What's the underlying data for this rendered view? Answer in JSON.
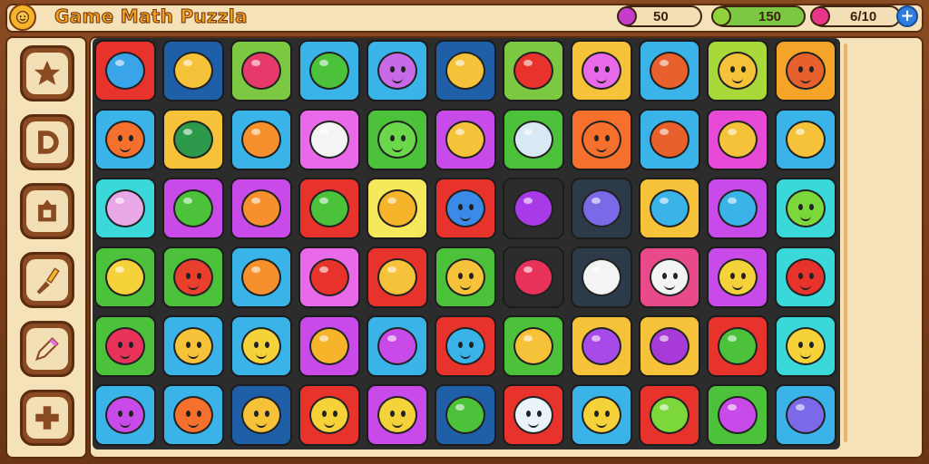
{
  "header": {
    "title": "Game Math Puzzla",
    "resources": [
      {
        "value": "50",
        "gem_color": "#c43cc8"
      },
      {
        "value": "150",
        "gem_color": "#8fd23a"
      },
      {
        "value": "6/10",
        "gem_color": "#e8358a"
      }
    ],
    "plus_label": "+"
  },
  "sidebar": {
    "items": [
      {
        "name": "star-icon"
      },
      {
        "name": "letter-d-icon"
      },
      {
        "name": "lock-icon"
      },
      {
        "name": "brush-icon"
      },
      {
        "name": "pencil-icon"
      },
      {
        "name": "cross-icon"
      }
    ]
  },
  "board": {
    "rows": [
      [
        {
          "bg": "#e8322c",
          "fg": "#3aa4e8",
          "kind": "blob"
        },
        {
          "bg": "#1f5fa8",
          "fg": "#f5c23a",
          "kind": "blob"
        },
        {
          "bg": "#7cc843",
          "fg": "#e83a6a",
          "kind": "blob"
        },
        {
          "bg": "#3ab4e8",
          "fg": "#4cc23a",
          "kind": "blob"
        },
        {
          "bg": "#3ab4e8",
          "fg": "#c86ae8",
          "kind": "face"
        },
        {
          "bg": "#1f5fa8",
          "fg": "#f5c23a",
          "kind": "blob"
        },
        {
          "bg": "#7cc843",
          "fg": "#e8322c",
          "kind": "blob"
        },
        {
          "bg": "#f5c23a",
          "fg": "#e86ae8",
          "kind": "face"
        },
        {
          "bg": "#3ab4e8",
          "fg": "#e8602c",
          "kind": "blob"
        },
        {
          "bg": "#a8d83a",
          "fg": "#f5c23a",
          "kind": "face"
        },
        {
          "bg": "#f5a42a",
          "fg": "#e8602c",
          "kind": "face"
        }
      ],
      [
        {
          "bg": "#3ab4e8",
          "fg": "#f5702c",
          "kind": "face"
        },
        {
          "bg": "#f5c23a",
          "fg": "#2c9a4a",
          "kind": "blob"
        },
        {
          "bg": "#3ab4e8",
          "fg": "#f5902c",
          "kind": "blob"
        },
        {
          "bg": "#e86ae8",
          "fg": "#f4f4f4",
          "kind": "blob"
        },
        {
          "bg": "#4cc23a",
          "fg": "#6ad84a",
          "kind": "face"
        },
        {
          "bg": "#c84ae8",
          "fg": "#f5c23a",
          "kind": "blob"
        },
        {
          "bg": "#4cc23a",
          "fg": "#d8e8f4",
          "kind": "blob"
        },
        {
          "bg": "#f5702c",
          "fg": "#f5702c",
          "kind": "face"
        },
        {
          "bg": "#3ab4e8",
          "fg": "#e8602c",
          "kind": "blob"
        },
        {
          "bg": "#e84ad8",
          "fg": "#f5c23a",
          "kind": "blob"
        },
        {
          "bg": "#3ab4e8",
          "fg": "#f5c23a",
          "kind": "blob"
        }
      ],
      [
        {
          "bg": "#3ad8d8",
          "fg": "#e8a8e8",
          "kind": "blob"
        },
        {
          "bg": "#c84ae8",
          "fg": "#4cc23a",
          "kind": "blob"
        },
        {
          "bg": "#c84ae8",
          "fg": "#f5902c",
          "kind": "blob"
        },
        {
          "bg": "#e8322c",
          "fg": "#4cc23a",
          "kind": "blob"
        },
        {
          "bg": "#f5e85a",
          "fg": "#f5b42a",
          "kind": "blob"
        },
        {
          "bg": "#e8322c",
          "fg": "#3a8ae8",
          "kind": "face"
        },
        {
          "bg": "#2c2c2c",
          "fg": "#a83ae8",
          "kind": "blob"
        },
        {
          "bg": "#2c3a4a",
          "fg": "#7a6ae8",
          "kind": "blob"
        },
        {
          "bg": "#f5c23a",
          "fg": "#3ab4e8",
          "kind": "blob"
        },
        {
          "bg": "#c84ae8",
          "fg": "#3ab4e8",
          "kind": "blob"
        },
        {
          "bg": "#3ad8d8",
          "fg": "#7cd83a",
          "kind": "face"
        }
      ],
      [
        {
          "bg": "#4cc23a",
          "fg": "#f5d23a",
          "kind": "blob"
        },
        {
          "bg": "#4cc23a",
          "fg": "#e8402c",
          "kind": "face"
        },
        {
          "bg": "#3ab4e8",
          "fg": "#f5902c",
          "kind": "blob"
        },
        {
          "bg": "#e86ae8",
          "fg": "#e8322c",
          "kind": "blob"
        },
        {
          "bg": "#e8322c",
          "fg": "#f5c23a",
          "kind": "blob"
        },
        {
          "bg": "#4cc23a",
          "fg": "#f5c23a",
          "kind": "face"
        },
        {
          "bg": "#2c2c2c",
          "fg": "#e8325a",
          "kind": "blob"
        },
        {
          "bg": "#2c3a4a",
          "fg": "#f4f4f4",
          "kind": "blob"
        },
        {
          "bg": "#e84a8a",
          "fg": "#f4f4f4",
          "kind": "face"
        },
        {
          "bg": "#c84ae8",
          "fg": "#f5d23a",
          "kind": "face"
        },
        {
          "bg": "#3ad8d8",
          "fg": "#e8322c",
          "kind": "face"
        }
      ],
      [
        {
          "bg": "#4cc23a",
          "fg": "#e8325a",
          "kind": "face"
        },
        {
          "bg": "#3ab4e8",
          "fg": "#f5c23a",
          "kind": "face"
        },
        {
          "bg": "#3ab4e8",
          "fg": "#f5d23a",
          "kind": "face"
        },
        {
          "bg": "#c84ae8",
          "fg": "#f5b42a",
          "kind": "blob"
        },
        {
          "bg": "#3ab4e8",
          "fg": "#c84ae8",
          "kind": "blob"
        },
        {
          "bg": "#e8322c",
          "fg": "#3ab4e8",
          "kind": "face"
        },
        {
          "bg": "#4cc23a",
          "fg": "#f5c23a",
          "kind": "blob"
        },
        {
          "bg": "#f5c23a",
          "fg": "#a84ae8",
          "kind": "blob"
        },
        {
          "bg": "#f5c23a",
          "fg": "#a83ad8",
          "kind": "blob"
        },
        {
          "bg": "#e8322c",
          "fg": "#4cc23a",
          "kind": "blob"
        },
        {
          "bg": "#3ad8d8",
          "fg": "#f5d23a",
          "kind": "face"
        }
      ],
      [
        {
          "bg": "#3ab4e8",
          "fg": "#c84ae8",
          "kind": "face"
        },
        {
          "bg": "#3ab4e8",
          "fg": "#f5702c",
          "kind": "face"
        },
        {
          "bg": "#1f5fa8",
          "fg": "#f5c23a",
          "kind": "face"
        },
        {
          "bg": "#e8322c",
          "fg": "#f5d23a",
          "kind": "face"
        },
        {
          "bg": "#c84ae8",
          "fg": "#f5d23a",
          "kind": "face"
        },
        {
          "bg": "#1f5fa8",
          "fg": "#4cc23a",
          "kind": "blob"
        },
        {
          "bg": "#e8322c",
          "fg": "#e8f4f8",
          "kind": "face"
        },
        {
          "bg": "#3ab4e8",
          "fg": "#f5d23a",
          "kind": "face"
        },
        {
          "bg": "#e8322c",
          "fg": "#7cd83a",
          "kind": "blob"
        },
        {
          "bg": "#4cc23a",
          "fg": "#c84ae8",
          "kind": "blob"
        },
        {
          "bg": "#3ab4e8",
          "fg": "#7a6ae8",
          "kind": "blob"
        }
      ]
    ]
  }
}
